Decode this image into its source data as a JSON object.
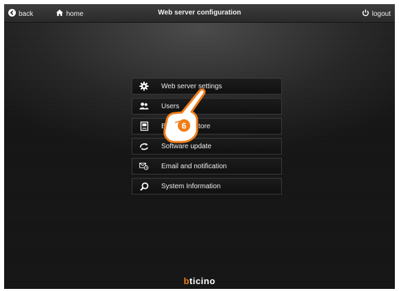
{
  "header": {
    "back_label": "back",
    "home_label": "home",
    "title": "Web server configuration",
    "logout_label": "logout"
  },
  "menu": {
    "items": [
      {
        "label": "Web server settings",
        "icon": "gear-icon"
      },
      {
        "label": "Users",
        "icon": "users-icon"
      },
      {
        "label": "Backup Restore",
        "icon": "backup-icon"
      },
      {
        "label": "Software update",
        "icon": "update-icon"
      },
      {
        "label": "Email and notification",
        "icon": "email-icon"
      },
      {
        "label": "System Information",
        "icon": "search-icon"
      }
    ]
  },
  "annotation": {
    "step_number": "6"
  },
  "brand": {
    "logo_b": "b",
    "logo_rest": "ticino"
  },
  "colors": {
    "accent": "#f07d1a",
    "background": "#262626",
    "text": "#efefef"
  }
}
